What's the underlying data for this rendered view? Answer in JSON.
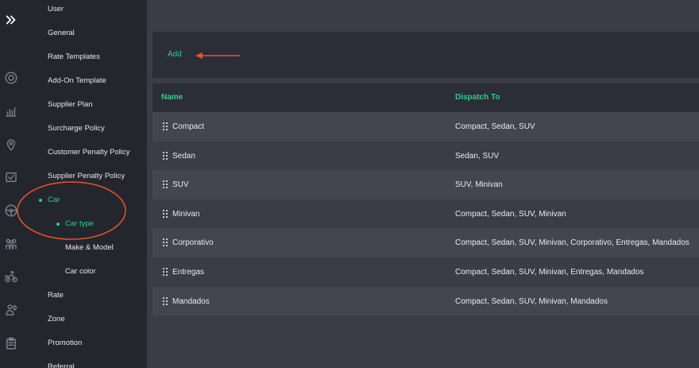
{
  "sidebar": {
    "items": [
      {
        "label": "User"
      },
      {
        "label": "General"
      },
      {
        "label": "Rate Templates"
      },
      {
        "label": "Add-On Template"
      },
      {
        "label": "Supplier Plan"
      },
      {
        "label": "Surcharge Policy"
      },
      {
        "label": "Customer Penalty Policy"
      },
      {
        "label": "Supplier Penalty Policy"
      },
      {
        "label": "Car"
      },
      {
        "label": "Car type"
      },
      {
        "label": "Make & Model"
      },
      {
        "label": "Car color"
      },
      {
        "label": "Rate"
      },
      {
        "label": "Zone"
      },
      {
        "label": "Promotion"
      },
      {
        "label": "Referral"
      }
    ],
    "active_color": "#2fce8a"
  },
  "icons": [
    "expand-icon",
    "target-icon",
    "chart-icon",
    "map-pin-icon",
    "checklist-icon",
    "steering-wheel-icon",
    "people-icon",
    "cyclist-icon",
    "user-location-icon",
    "clipboard-icon"
  ],
  "toolbar": {
    "add_label": "Add"
  },
  "table": {
    "headers": {
      "name": "Name",
      "dispatch": "Dispatch To"
    },
    "rows": [
      {
        "name": "Compact",
        "dispatch": "Compact, Sedan, SUV"
      },
      {
        "name": "Sedan",
        "dispatch": "Sedan, SUV"
      },
      {
        "name": "SUV",
        "dispatch": "SUV, Minivan"
      },
      {
        "name": "Minivan",
        "dispatch": "Compact, Sedan, SUV, Minivan"
      },
      {
        "name": "Corporativo",
        "dispatch": "Compact, Sedan, SUV, Minivan, Corporativo, Entregas, Mandados"
      },
      {
        "name": "Entregas",
        "dispatch": "Compact, Sedan, SUV, Minivan, Entregas, Mandados"
      },
      {
        "name": "Mandados",
        "dispatch": "Compact, Sedan, SUV, Minivan, Mandados"
      }
    ]
  },
  "colors": {
    "accent": "#2fce8a",
    "annotation": "#e8542a"
  }
}
